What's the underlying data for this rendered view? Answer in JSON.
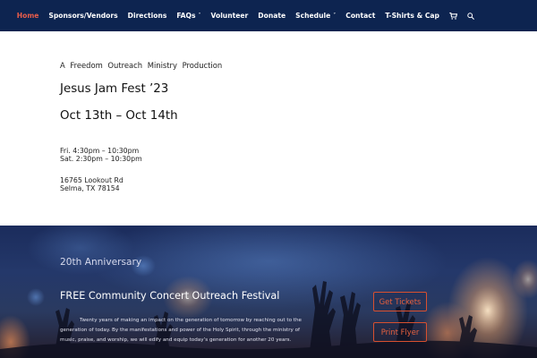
{
  "nav": {
    "items": [
      {
        "label": "Home",
        "active": true,
        "dropdown": false
      },
      {
        "label": "Sponsors/Vendors",
        "active": false,
        "dropdown": false
      },
      {
        "label": "Directions",
        "active": false,
        "dropdown": false
      },
      {
        "label": "FAQs",
        "active": false,
        "dropdown": true
      },
      {
        "label": "Volunteer",
        "active": false,
        "dropdown": false
      },
      {
        "label": "Donate",
        "active": false,
        "dropdown": false
      },
      {
        "label": "Schedule",
        "active": false,
        "dropdown": true
      },
      {
        "label": "Contact",
        "active": false,
        "dropdown": false
      },
      {
        "label": "T-Shirts & Cap",
        "active": false,
        "dropdown": false
      }
    ],
    "icons": [
      "cart-icon",
      "search-icon"
    ],
    "background": "#0d2450",
    "active_color": "#e85d4a"
  },
  "intro": {
    "tagline": "A Freedom Outreach Ministry Production",
    "event_title": "Jesus Jam Fest ’23",
    "dates": "Oct 13th – Oct 14th",
    "times": [
      "Fri.  4:30pm – 10:30pm",
      "Sat. 2:30pm – 10:30pm"
    ],
    "address": [
      "16765 Lookout Rd",
      "Selma, TX 78154"
    ]
  },
  "concert": {
    "anniversary": "20th Anniversary",
    "festival_title": "FREE Community Concert Outreach Festival",
    "description": "Twenty years of making an impact on the generation of tomorrow by reaching out to the generation of today. By the manifestations and power of the Holy Spirit, through the ministry of music, praise, and worship, we will edify and equip today’s generation for another 20 years.",
    "buttons": {
      "tickets": "Get Tickets",
      "flyer": "Print Flyer"
    },
    "button_color": "#d8502f"
  }
}
